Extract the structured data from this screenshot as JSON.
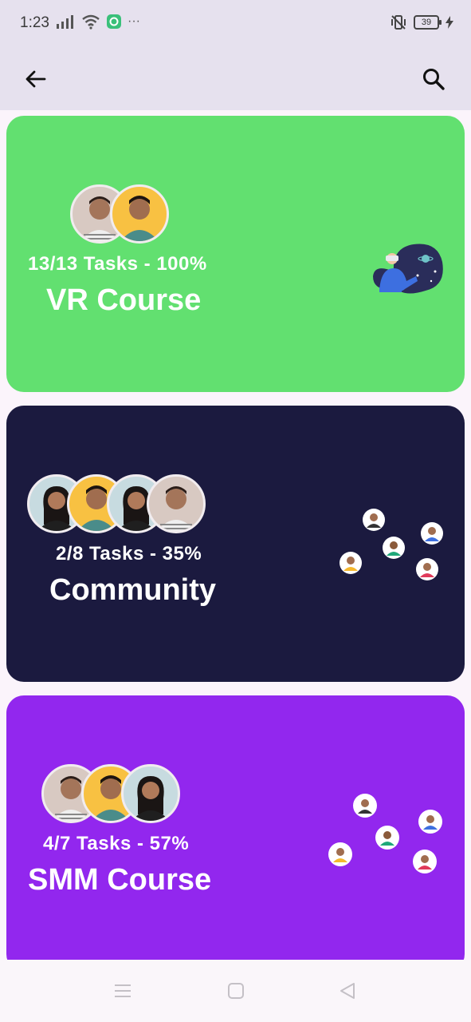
{
  "status_bar": {
    "time": "1:23",
    "more": "···",
    "battery": "39"
  },
  "app_bar": {
    "back_icon": "arrow-left-icon",
    "search_icon": "search-icon"
  },
  "cards": [
    {
      "tasks_text": "13/13 Tasks - 100%",
      "title": "VR Course",
      "color": "#62e070",
      "progress": 1.0,
      "avatar_count": 2,
      "illustration": "vr-headset-illustration"
    },
    {
      "tasks_text": "2/8 Tasks - 35%",
      "title": "Community",
      "color": "#1b1a3f",
      "progress": 0.35,
      "avatar_count": 4,
      "illustration": "people-network-illustration"
    },
    {
      "tasks_text": "4/7 Tasks - 57%",
      "title": "SMM Course",
      "color": "#9227ee",
      "progress": 0.57,
      "avatar_count": 3,
      "illustration": "people-network-illustration"
    }
  ],
  "nav_bar": {
    "menu_icon": "menu-icon",
    "home_icon": "home-square-icon",
    "back_icon": "back-triangle-icon"
  }
}
